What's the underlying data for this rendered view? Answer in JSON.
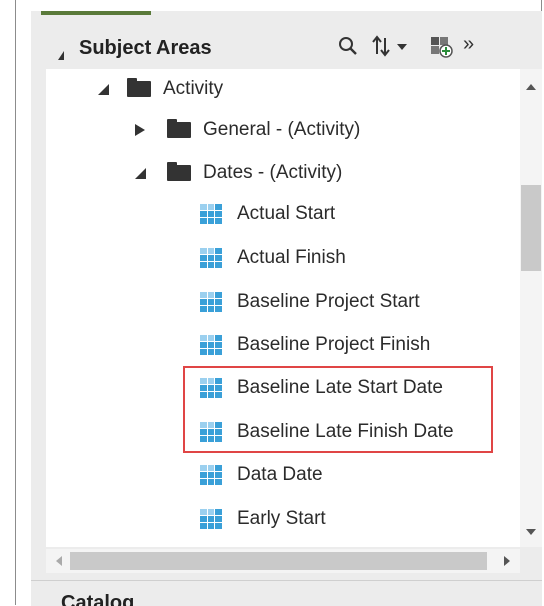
{
  "panel": {
    "title": "Subject Areas",
    "icons": {
      "search": "search-icon",
      "sort": "sort-icon",
      "add": "add-subject-area-icon",
      "more": "more-icon"
    }
  },
  "tree": {
    "root": {
      "label": "Activity",
      "expanded": true
    },
    "folders": [
      {
        "label": "General - (Activity)",
        "expanded": false
      },
      {
        "label": "Dates - (Activity)",
        "expanded": true
      }
    ],
    "columns": [
      "Actual Start",
      "Actual Finish",
      "Baseline Project Start",
      "Baseline Project Finish",
      "Baseline Late Start Date",
      "Baseline Late Finish Date",
      "Data Date",
      "Early Start"
    ],
    "highlighted": [
      "Baseline Late Start Date",
      "Baseline Late Finish Date"
    ],
    "highlight_color": "#e04545"
  },
  "catalog": {
    "title": "Catalog"
  },
  "colors": {
    "accent": "#5a7a3a",
    "column_icon": "#3aa0d8",
    "panel_bg": "#ececec"
  }
}
